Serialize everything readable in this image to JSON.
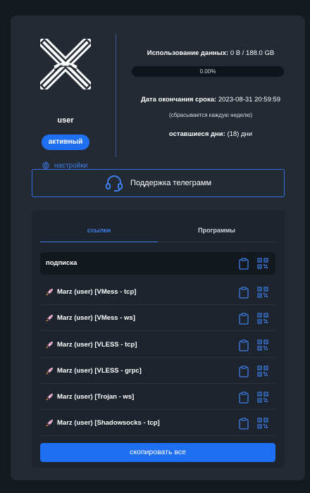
{
  "profile": {
    "username": "user",
    "status": "активный",
    "settings_label": "настройки"
  },
  "usage": {
    "data_label": "Использование данных:",
    "data_value": "0 B / 188.0 GB",
    "progress_text": "0.00%",
    "progress": 0.0,
    "expiry_label": "Дата окончания срока:",
    "expiry_value": "2023-08-31 20:59:59",
    "reset_note": "(сбрасывается каждую неделю)",
    "remaining_label": "оставшиеся дни:",
    "remaining_value": "(18) дни"
  },
  "support": {
    "label": "Поддержка телеграмм"
  },
  "tabs": [
    {
      "label": "ссылки"
    },
    {
      "label": "Программы"
    }
  ],
  "subscription": {
    "label": "подписка"
  },
  "links": [
    {
      "label": "Marz (user) [VMess - tcp]"
    },
    {
      "label": "Marz (user) [VMess - ws]"
    },
    {
      "label": "Marz (user) [VLESS - tcp]"
    },
    {
      "label": "Marz (user) [VLESS - grpc]"
    },
    {
      "label": "Marz (user) [Trojan - ws]"
    },
    {
      "label": "Marz (user) [Shadowsocks - tcp]"
    }
  ],
  "copy_all": {
    "label": "скопировать все"
  },
  "colors": {
    "accent": "#1f6ff2",
    "card": "#232a34",
    "background": "#151a21"
  },
  "icons": [
    "xray-logo-icon",
    "gear-icon",
    "headset-icon",
    "clipboard-icon",
    "qr-code-icon",
    "rocket-icon"
  ]
}
